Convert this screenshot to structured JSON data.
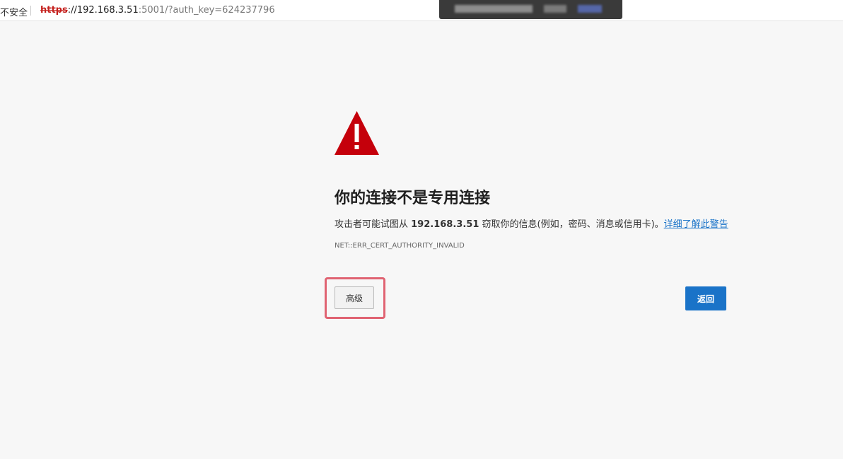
{
  "addressbar": {
    "security_text": "不安全",
    "url_scheme": "https",
    "url_host": "://192.168.3.51",
    "url_rest": ":5001/?auth_key=624237796"
  },
  "interstitial": {
    "headline": "你的连接不是专用连接",
    "message_prefix": "攻击者可能试图从 ",
    "host": "192.168.3.51",
    "message_suffix": " 窃取你的信息(例如，密码、消息或信用卡)。",
    "learn_more_link": "详细了解此警告",
    "error_code": "NET::ERR_CERT_AUTHORITY_INVALID",
    "advanced_label": "高级",
    "back_label": "返回"
  },
  "colors": {
    "warning_red": "#c5000b",
    "link_blue": "#1a73c8",
    "highlight_pink": "#e06372"
  },
  "icons": {
    "warning": "warning-triangle-icon"
  }
}
